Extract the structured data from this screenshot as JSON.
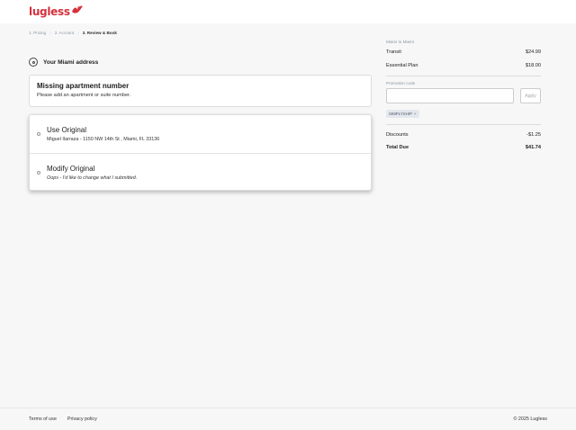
{
  "brand": {
    "name": "lugless",
    "color": "#d6303d"
  },
  "breadcrumb": [
    {
      "label": "1. Pricing"
    },
    {
      "label": "2. Account"
    },
    {
      "label": "3. Review & Book"
    }
  ],
  "address_section": {
    "title": "Your Miami address",
    "icon": "location-pin-icon"
  },
  "alert": {
    "title": "Missing apartment number",
    "message": "Please add an apartment or suite number."
  },
  "options": [
    {
      "label": "Use Original",
      "detail": "Miguel Ilarraza - 1150 NW 14th St , Miami, FL 33136"
    },
    {
      "label": "Modify Original",
      "detail": "Oops - I'd like to change what I submitted."
    }
  ],
  "summary": {
    "route": "Miami to Miami",
    "transit_label": "Transit",
    "transit_value": "$24.99",
    "plan_label": "Essential Plan",
    "plan_value": "$18.00",
    "promo_label": "Promotion code",
    "promo_placeholder": "",
    "apply_label": "Apply",
    "applied_code": "SIMPLYSHIP",
    "discounts_label": "Discounts",
    "discounts_value": "-$1.25",
    "total_label": "Total Due",
    "total_value": "$41.74"
  },
  "footer": {
    "terms": "Terms of use",
    "privacy": "Privacy policy",
    "copyright": "© 2025 Lugless"
  }
}
